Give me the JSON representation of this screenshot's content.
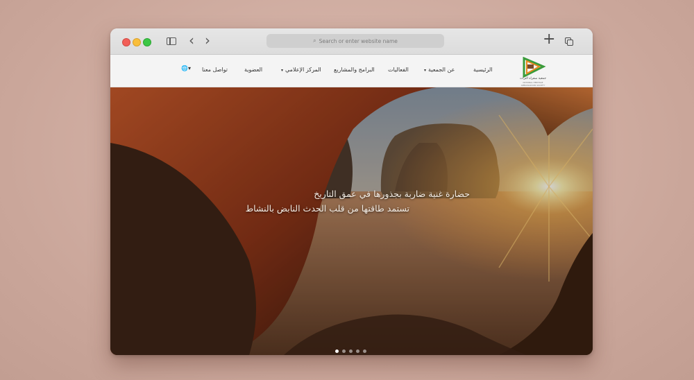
{
  "browser": {
    "url_placeholder": "Search or enter website name",
    "icons": [
      "sidebar-icon",
      "back-icon",
      "forward-icon",
      "search-icon",
      "new-tab-icon",
      "tabs-overview-icon"
    ]
  },
  "logo": {
    "name": "جمعية سفراء التراث",
    "subtitle": "NATIONAL HERITAGE AMBASSADORS SOCIETY"
  },
  "nav": {
    "items": [
      {
        "label": "الرئيسية",
        "dropdown": false
      },
      {
        "label": "عن الجمعية",
        "dropdown": true
      },
      {
        "label": "الفعاليات",
        "dropdown": false
      },
      {
        "label": "البرامج والمشاريع",
        "dropdown": false
      },
      {
        "label": "المركز الإعلامي",
        "dropdown": true
      },
      {
        "label": "العضوية",
        "dropdown": false
      },
      {
        "label": "تواصل معنا",
        "dropdown": false
      }
    ],
    "caret": "▾",
    "globe": "🌐▾"
  },
  "hero": {
    "line1": "حضارة غنية ضاربة بجذورها في عمق التاريخ",
    "line2": "تستمد طاقتها من قلب الحدث النابض بالنشاط",
    "slides": 5,
    "active_slide": 1
  },
  "colors": {
    "accent_green": "#3a9b3a",
    "accent_orange": "#e98a1f",
    "hero_text": "#f3ece4"
  }
}
